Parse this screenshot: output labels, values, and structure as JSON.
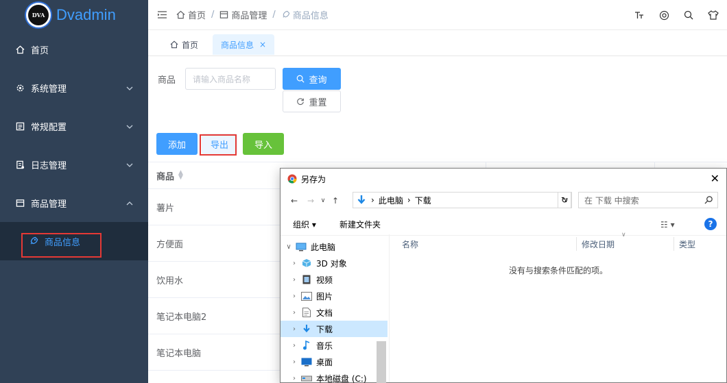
{
  "app": {
    "logo_badge": "DVA",
    "name": "Dvadmin"
  },
  "sidebar": {
    "items": [
      {
        "label": "首页",
        "icon": "home-icon"
      },
      {
        "label": "系统管理",
        "icon": "gear-icon"
      },
      {
        "label": "常规配置",
        "icon": "list-icon"
      },
      {
        "label": "日志管理",
        "icon": "log-icon"
      },
      {
        "label": "商品管理",
        "icon": "box-icon"
      }
    ],
    "sub_item": {
      "label": "商品信息",
      "icon": "rocket-icon"
    }
  },
  "header": {
    "breadcrumb": [
      "首页",
      "商品管理",
      "商品信息"
    ],
    "sep": "/"
  },
  "tags": {
    "home": "首页",
    "active": "商品信息",
    "close": "×"
  },
  "search": {
    "label": "商品",
    "placeholder": "请输入商品名称",
    "query": "查询",
    "reset": "重置"
  },
  "actions": {
    "add": "添加",
    "export": "导出",
    "import": "导入"
  },
  "table": {
    "header": "商品",
    "rows": [
      "薯片",
      "方便面",
      "饮用水",
      "笔记本电脑2",
      "笔记本电脑"
    ]
  },
  "dialog": {
    "title": "另存为",
    "close": "✕",
    "path": [
      "此电脑",
      "下载"
    ],
    "search_placeholder": "在 下载 中搜索",
    "organize": "组织 ▾",
    "new_folder": "新建文件夹",
    "tree": [
      {
        "label": "此电脑",
        "icon": "computer-icon",
        "level": "top"
      },
      {
        "label": "3D 对象",
        "icon": "cube-icon",
        "level": "child"
      },
      {
        "label": "视频",
        "icon": "video-icon",
        "level": "child"
      },
      {
        "label": "图片",
        "icon": "picture-icon",
        "level": "child"
      },
      {
        "label": "文档",
        "icon": "document-icon",
        "level": "child"
      },
      {
        "label": "下载",
        "icon": "download-icon",
        "level": "child",
        "selected": true
      },
      {
        "label": "音乐",
        "icon": "music-icon",
        "level": "child"
      },
      {
        "label": "桌面",
        "icon": "desktop-icon",
        "level": "child"
      },
      {
        "label": "本地磁盘 (C:)",
        "icon": "drive-icon",
        "level": "child"
      }
    ],
    "columns": [
      "名称",
      "修改日期",
      "类型"
    ],
    "empty": "没有与搜索条件匹配的项。"
  }
}
